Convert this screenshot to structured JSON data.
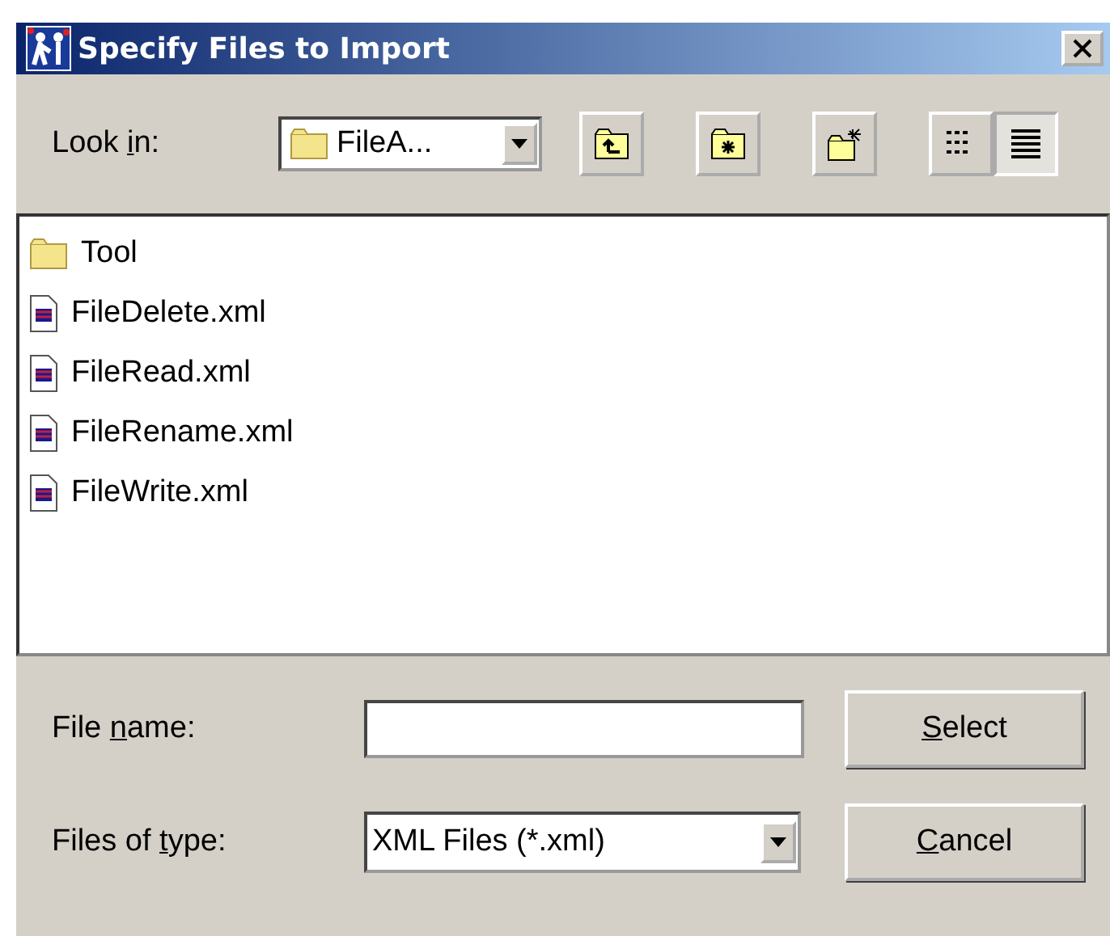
{
  "window": {
    "title": "Specify Files to Import"
  },
  "look_in": {
    "label": [
      {
        "text": "Look "
      },
      {
        "text": "i",
        "underline": true
      },
      {
        "text": "n:"
      }
    ],
    "value": "FileA..."
  },
  "toolbar": [
    {
      "kind": "up"
    },
    {
      "kind": "home"
    },
    {
      "kind": "new"
    },
    {
      "kind": "list",
      "selected": false
    },
    {
      "kind": "details",
      "selected": true
    }
  ],
  "files": [
    {
      "kind": "folder",
      "name": "Tool"
    },
    {
      "kind": "xml",
      "name": "FileDelete.xml"
    },
    {
      "kind": "xml",
      "name": "FileRead.xml"
    },
    {
      "kind": "xml",
      "name": "FileRename.xml"
    },
    {
      "kind": "xml",
      "name": "FileWrite.xml"
    }
  ],
  "file_name": {
    "label": [
      {
        "text": "File "
      },
      {
        "text": "n",
        "underline": true
      },
      {
        "text": "ame:"
      }
    ]
  },
  "file_type": {
    "label": [
      {
        "text": "Files of "
      },
      {
        "text": "t",
        "underline": true
      },
      {
        "text": "ype:"
      }
    ],
    "value": "XML Files (*.xml)"
  },
  "buttons": [
    {
      "label": [
        {
          "text": "S",
          "underline": true
        },
        {
          "text": "elect"
        }
      ]
    },
    {
      "label": [
        {
          "text": "C",
          "underline": true
        },
        {
          "text": "ancel"
        }
      ]
    }
  ]
}
